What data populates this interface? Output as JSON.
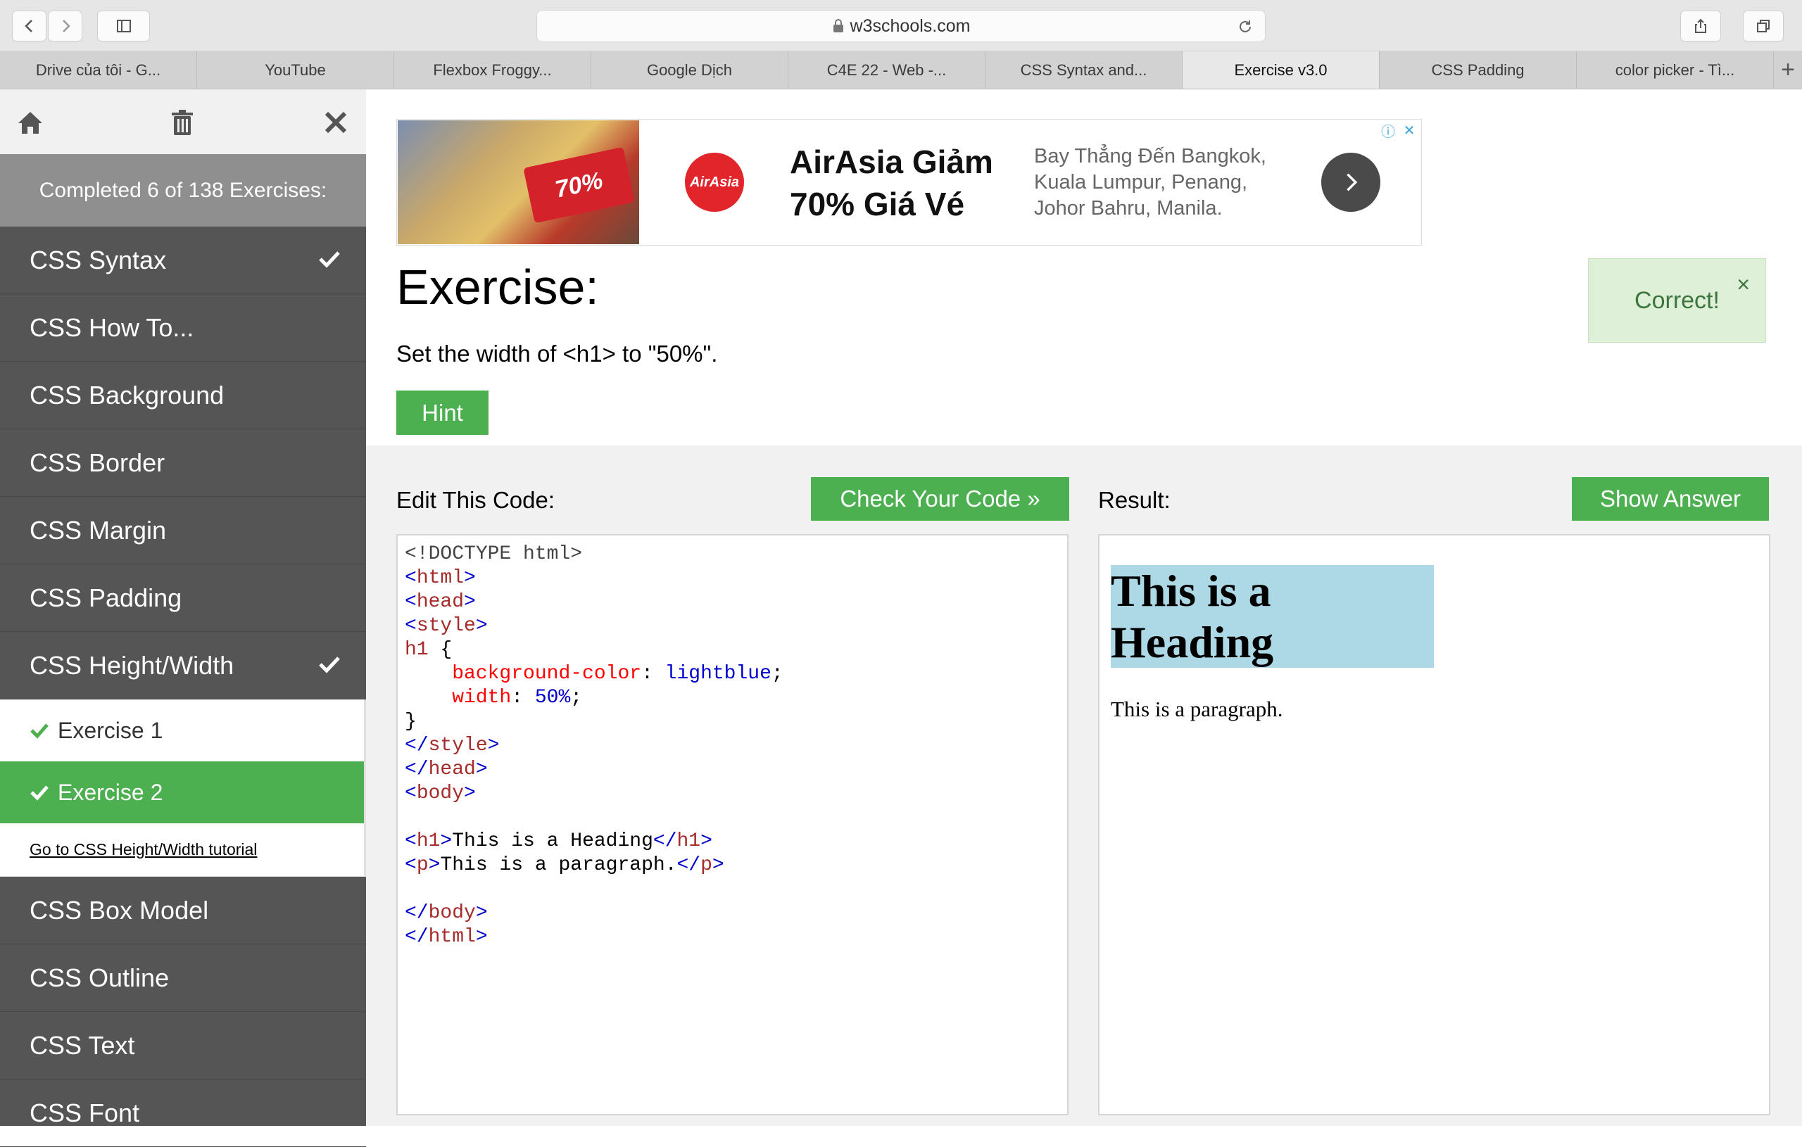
{
  "browser": {
    "url": "w3schools.com",
    "tabs": [
      {
        "label": "Drive của tôi - G..."
      },
      {
        "label": "YouTube"
      },
      {
        "label": "Flexbox Froggy..."
      },
      {
        "label": "Google Dịch"
      },
      {
        "label": "C4E 22 - Web -..."
      },
      {
        "label": "CSS Syntax and..."
      },
      {
        "label": "Exercise v3.0"
      },
      {
        "label": "CSS Padding"
      },
      {
        "label": "color picker - Tì..."
      }
    ],
    "add_tab": "+"
  },
  "sidebar": {
    "progress": "Completed 6 of 138 Exercises:",
    "items_top": [
      {
        "label": "CSS Syntax"
      },
      {
        "label": "CSS How To..."
      },
      {
        "label": "CSS Background"
      },
      {
        "label": "CSS Border"
      },
      {
        "label": "CSS Margin"
      },
      {
        "label": "CSS Padding"
      },
      {
        "label": "CSS Height/Width"
      }
    ],
    "sub_items": [
      {
        "label": "Exercise 1"
      },
      {
        "label": "Exercise 2"
      }
    ],
    "tutorial_link": "Go to CSS Height/Width tutorial",
    "items_bottom": [
      {
        "label": "CSS Box Model"
      },
      {
        "label": "CSS Outline"
      },
      {
        "label": "CSS Text"
      },
      {
        "label": "CSS Font"
      }
    ]
  },
  "ad": {
    "banner_text": "70%",
    "logo_text": "AirAsia",
    "title": "AirAsia Giảm 70% Giá Vé",
    "description": "Bay Thẳng Đến Bangkok, Kuala Lumpur, Penang, Johor Bahru, Manila."
  },
  "exercise": {
    "title": "Exercise:",
    "instruction": "Set the width of <h1> to \"50%\".",
    "hint": "Hint"
  },
  "toast": {
    "message": "Correct!",
    "close": "×"
  },
  "editor": {
    "label": "Edit This Code:",
    "check_button": "Check Your Code »",
    "code": {
      "doctype": "<!DOCTYPE html>",
      "selector": "h1",
      "prop1": "background-color",
      "val1": "lightblue",
      "prop2": "width",
      "val2": "50%",
      "h1_text": "This is a Heading",
      "p_text": "This is a paragraph."
    }
  },
  "result": {
    "label": "Result:",
    "show_answer": "Show Answer",
    "heading": "This is a Heading",
    "paragraph": "This is a paragraph."
  }
}
